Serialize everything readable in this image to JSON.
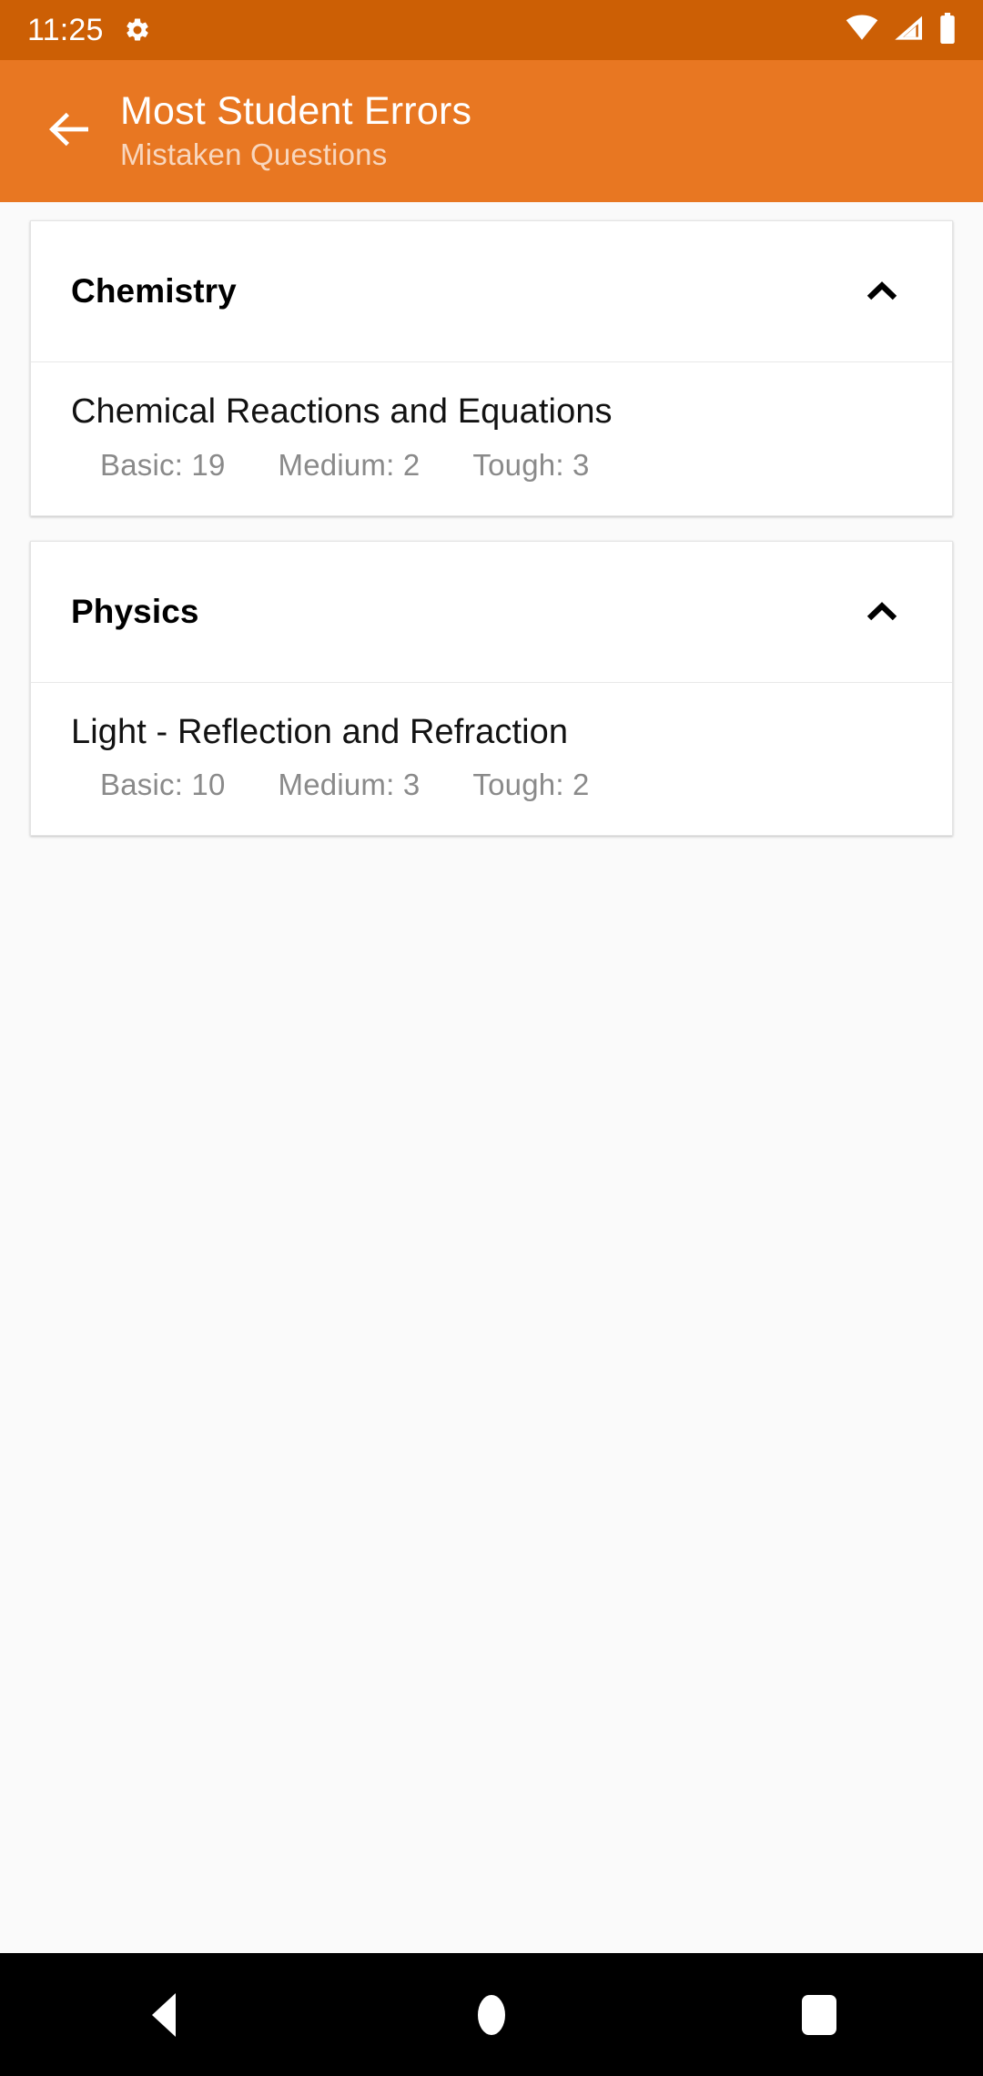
{
  "status_bar": {
    "time": "11:25",
    "gear_icon": "gear-icon",
    "wifi_icon": "wifi-icon",
    "cellular_icon": "cellular-signal-icon",
    "battery_icon": "battery-icon",
    "background_color": "#CC5F05"
  },
  "app_bar": {
    "back_icon": "arrow-left-icon",
    "title": "Most Student Errors",
    "subtitle": "Mistaken Questions",
    "background_color": "#E87722"
  },
  "content": {
    "background_color": "#FAFAFA",
    "subjects": [
      {
        "name": "Chemistry",
        "expanded": true,
        "chevron_icon": "chevron-up-icon",
        "chapters": [
          {
            "title": "Chemical Reactions and Equations",
            "difficulties": [
              {
                "label": "Basic: 19"
              },
              {
                "label": "Medium: 2"
              },
              {
                "label": "Tough: 3"
              }
            ]
          }
        ]
      },
      {
        "name": "Physics",
        "expanded": true,
        "chevron_icon": "chevron-up-icon",
        "chapters": [
          {
            "title": "Light - Reflection and Refraction",
            "difficulties": [
              {
                "label": "Basic: 10"
              },
              {
                "label": "Medium: 3"
              },
              {
                "label": "Tough: 2"
              }
            ]
          }
        ]
      }
    ]
  },
  "nav_bar": {
    "background_color": "#000000",
    "back_icon": "nav-back-triangle-icon",
    "home_icon": "nav-home-circle-icon",
    "recents_icon": "nav-recents-square-icon"
  }
}
